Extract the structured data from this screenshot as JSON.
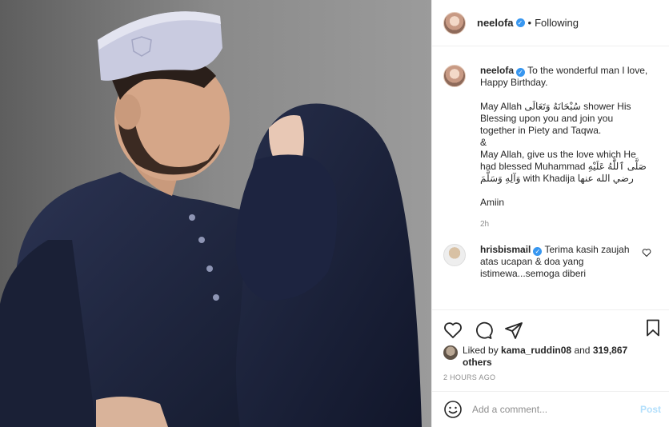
{
  "post": {
    "username": "neelofa",
    "follow_separator": "•",
    "follow_status": "Following",
    "verified": true
  },
  "caption": {
    "username": "neelofa",
    "lines": [
      "To the wonderful man I love, Happy Birthday.",
      "",
      "May Allah سُبْحَانَهُ وَتَعَالَى shower His Blessing upon you and join you together in Piety and Taqwa.",
      "&",
      "May Allah, give us the love which He had blessed Muhammad صَلَّى ٱللَّٰهُ عَلَيْهِ وَآلِهِ وَسَلَّمَ with Khadija رضي الله عنها",
      "",
      "Amiin"
    ],
    "time": "2h"
  },
  "comment": {
    "username": "hrisbismail",
    "text": "Terima kasih zaujah atas ucapan & doa yang istimewa...semoga diberi"
  },
  "likes": {
    "prefix": "Liked by",
    "user": "kama_ruddin08",
    "connector": "and",
    "others": "319,867 others"
  },
  "posted_time": "2 HOURS AGO",
  "add_comment": {
    "placeholder": "Add a comment...",
    "post_label": "Post"
  },
  "icons": {
    "like": "heart-icon",
    "comment": "comment-icon",
    "share": "share-icon",
    "save": "bookmark-icon",
    "emoji": "emoji-icon",
    "comment_like": "small-heart-icon",
    "verified": "verified-badge-icon"
  },
  "colors": {
    "verified": "#3897f0",
    "secondary_text": "#8e8e8e",
    "post_button_disabled": "#b2dffc",
    "navy_garment": "#1f2740"
  }
}
